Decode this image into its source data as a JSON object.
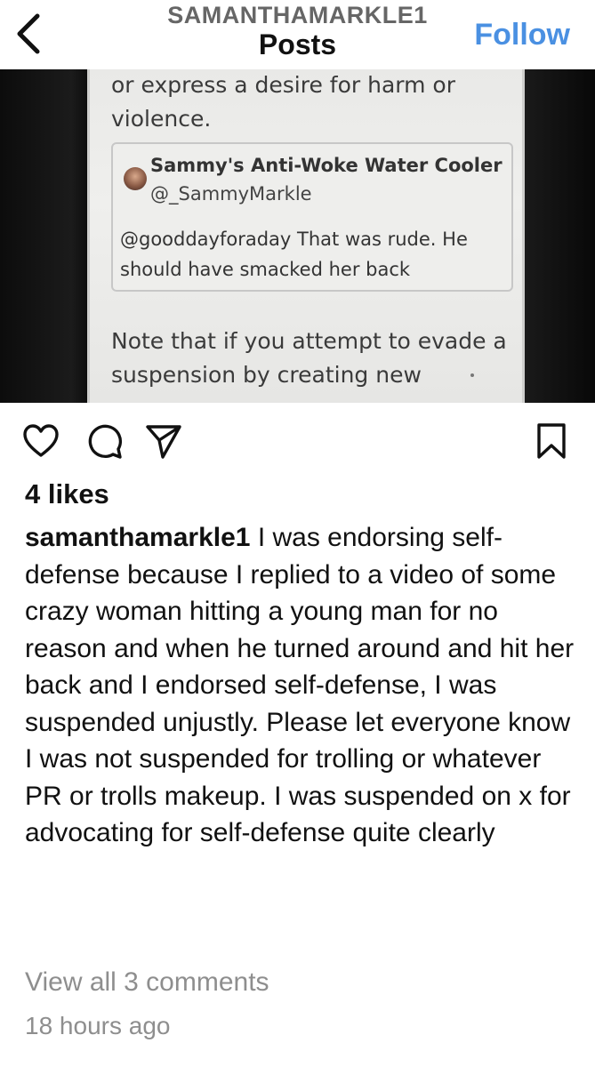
{
  "header": {
    "username": "SAMANTHAMARKLE1",
    "title": "Posts",
    "follow_label": "Follow"
  },
  "photo": {
    "line1": "or express a desire for harm or",
    "line2": "violence.",
    "quote": {
      "name": "Sammy's Anti-Woke Water Cooler",
      "handle": "@_SammyMarkle",
      "body": "@gooddayforaday That was rude. He should have smacked her back"
    },
    "note_line1": "Note that if you attempt to evade a",
    "note_line2": "suspension by creating new"
  },
  "post": {
    "likes": "4 likes",
    "username": "samanthamarkle1",
    "caption": " I was endorsing self-defense because I replied to a video of some crazy woman hitting a young man for no reason and when he turned around and hit her back and I endorsed self-defense, I was suspended unjustly. Please let everyone know I was not suspended for trolling or whatever PR or trolls makeup. I was suspended on x for advocating for self-defense quite clearly",
    "view_comments": "View all 3 comments",
    "timestamp": "18 hours ago"
  },
  "icons": [
    "back-chevron-icon",
    "heart-icon",
    "comment-icon",
    "share-icon",
    "bookmark-icon"
  ],
  "colors": {
    "follow": "#4a90e2",
    "muted": "#8e8e8e"
  }
}
